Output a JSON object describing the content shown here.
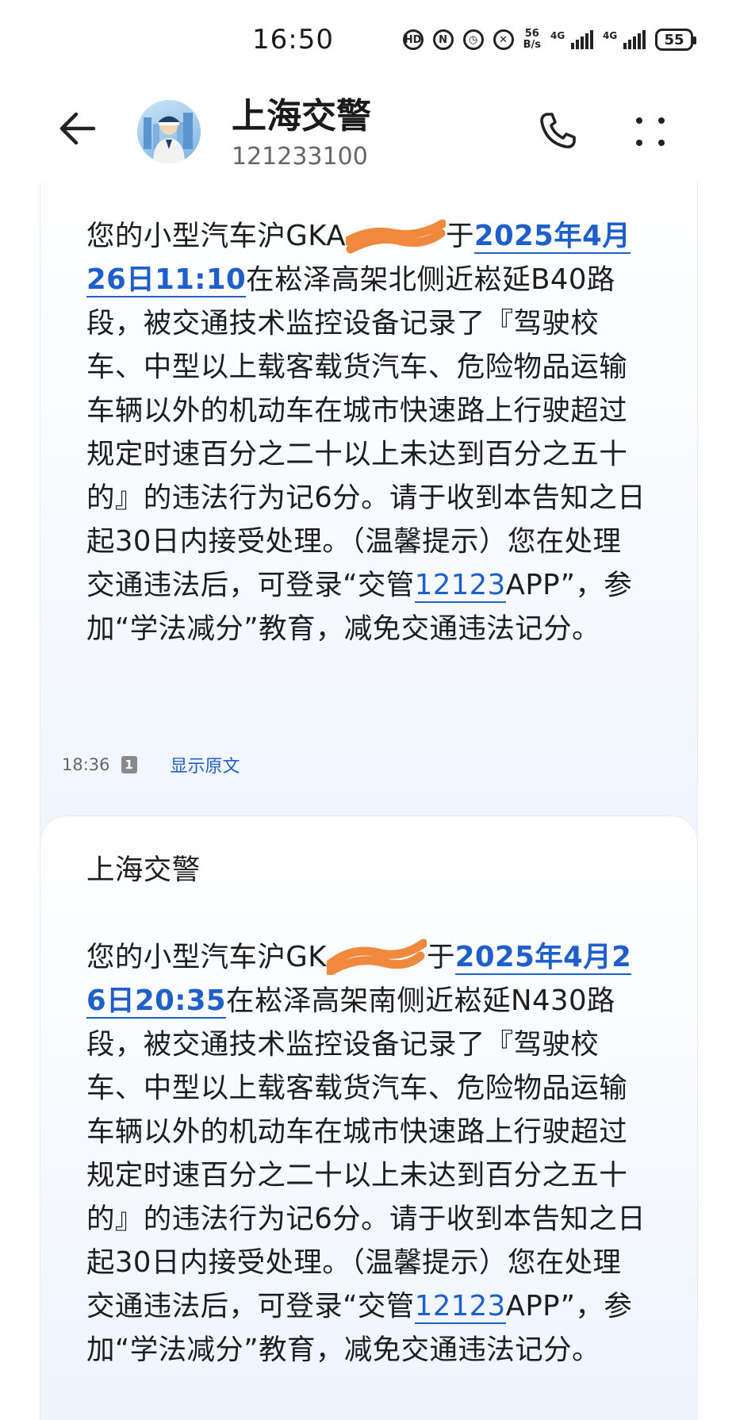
{
  "status_bar": {
    "time": "16:50",
    "net_speed_value": "56",
    "net_speed_unit": "B/s",
    "signal1_label": "4G",
    "signal2_label": "4G",
    "battery": "55",
    "icons": [
      "hd-icon",
      "nfc-icon",
      "alarm-icon",
      "mute-icon"
    ]
  },
  "header": {
    "contact_name": "上海交警",
    "contact_number": "121233100",
    "icons": [
      "back-arrow-icon",
      "avatar",
      "phone-icon",
      "more-icon"
    ]
  },
  "messages": [
    {
      "text_prefix": "您的小型汽车沪GKA",
      "text_after_redact": "于",
      "date_link": "2025年4月26日11:10",
      "body_a": "在崧泽高架北侧近崧延B40路段，被交通技术监控设备记录了『驾驶校车、中型以上载客载货汽车、危险物品运输车辆以外的机动车在城市快速路上行驶超过规定时速百分之二十以上未达到百分之五十的』的违法行为记6分。请于收到本告知之日起30日内接受处理。（温馨提示）您在处理交通违法后，可登录“交管",
      "app_link": "12123",
      "body_b": "APP”，参加“学法减分”教育，减免交通违法记分。"
    },
    {
      "sender": "上海交警",
      "text_prefix": "您的小型汽车沪GK",
      "text_after_redact": "于",
      "date_link": "2025年4月26日20:35",
      "body_a": "在崧泽高架南侧近崧延N430路段，被交通技术监控设备记录了『驾驶校车、中型以上载客载货汽车、危险物品运输车辆以外的机动车在城市快速路上行驶超过规定时速百分之二十以上未达到百分之五十的』的违法行为记6分。请于收到本告知之日起30日内接受处理。（温馨提示）您在处理交通违法后，可登录“交管",
      "app_link": "12123",
      "body_b": "APP”，参加“学法减分”教育，减免交通违法记分。"
    }
  ],
  "meta": {
    "time": "18:36",
    "sim": "1",
    "show_original": "显示原文"
  },
  "colors": {
    "link": "#1f5fc9",
    "redaction": "#f0883e",
    "bubble_top": "#ffffff",
    "bubble_bottom": "#eef4fd"
  }
}
